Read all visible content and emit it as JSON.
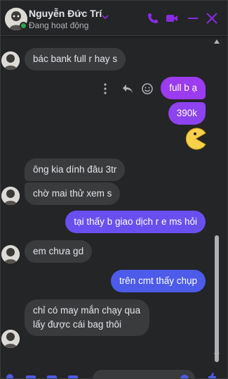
{
  "header": {
    "name": "Nguyễn Đức Trí",
    "status": "Đang hoạt động"
  },
  "colors": {
    "accent": "#8a2be2",
    "online": "#31a24c",
    "bubble_in": "#3a3b3c",
    "bubble_out_gradient_top": "#9b3cf0",
    "bubble_out_gradient_bottom": "#4c5bea"
  },
  "messages": [
    {
      "dir": "in",
      "text": "bác bank full r hay s"
    },
    {
      "dir": "out",
      "text": "full b ạ"
    },
    {
      "dir": "out",
      "text": "390k"
    },
    {
      "dir": "in",
      "text": "ông kia dính đâu 3tr"
    },
    {
      "dir": "in",
      "text": "chờ mai thử xem s"
    },
    {
      "dir": "out",
      "text": "tại thấy b giao dịch r e ms hỏi"
    },
    {
      "dir": "in",
      "text": "em chưa gd"
    },
    {
      "dir": "out",
      "text": "trên cmt thấy chụp"
    },
    {
      "dir": "in",
      "text": "chỉ có may mắn chạy qua lấy được cái bag thôi"
    }
  ],
  "icons": {
    "header": [
      "phone-icon",
      "video-icon",
      "minimize-icon",
      "close-icon"
    ],
    "message_actions": [
      "more-icon",
      "reply-icon",
      "emoji-icon"
    ],
    "sticker": "pacman-emoji"
  }
}
